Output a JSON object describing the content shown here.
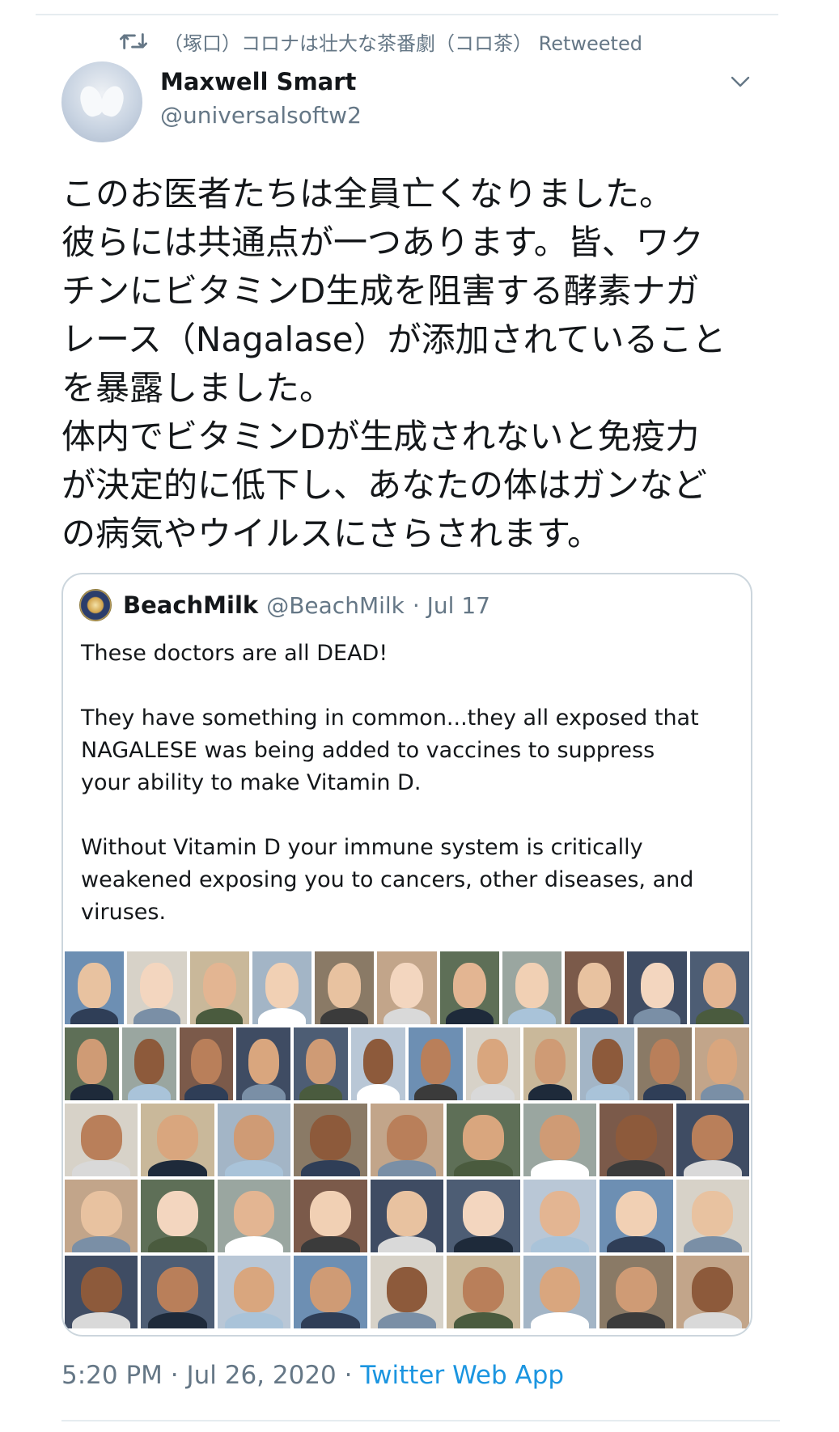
{
  "retweet": {
    "text": "（塚口）コロナは壮大な茶番劇（コロ茶） Retweeted"
  },
  "author": {
    "name": "Maxwell Smart",
    "handle": "@universalsoftw2"
  },
  "tweet_lines": [
    "このお医者たちは全員亡くなりました。",
    "彼らには共通点が一つあります。皆、ワク",
    "チンにビタミンD生成を阻害する酵素ナガ",
    "レース（Nagalase）が添加されていること",
    "を暴露しました。",
    "体内でビタミンDが生成されないと免疫力",
    "が決定的に低下し、あなたの体はガンなど",
    "の病気やウイルスにさらされます。"
  ],
  "quoted": {
    "name": "BeachMilk",
    "handle": "@BeachMilk",
    "date": "· Jul 17",
    "para1": [
      "These doctors are all DEAD!"
    ],
    "para2": [
      "They have something in common...they all exposed that",
      "NAGALESE was being added to vaccines to suppress",
      "your ability to make Vitamin D."
    ],
    "para3": [
      "Without Vitamin D your immune system is critically",
      "weakened exposing you to cancers, other diseases, and",
      "viruses."
    ],
    "photo_rows": [
      11,
      12,
      9,
      9,
      9
    ]
  },
  "footer": {
    "timestamp": "5:20 PM · Jul 26, 2020 · ",
    "source": "Twitter Web App"
  },
  "colors": {
    "secondary_text": "#657786",
    "link": "#1b95e0",
    "border": "#ccd6dd"
  }
}
